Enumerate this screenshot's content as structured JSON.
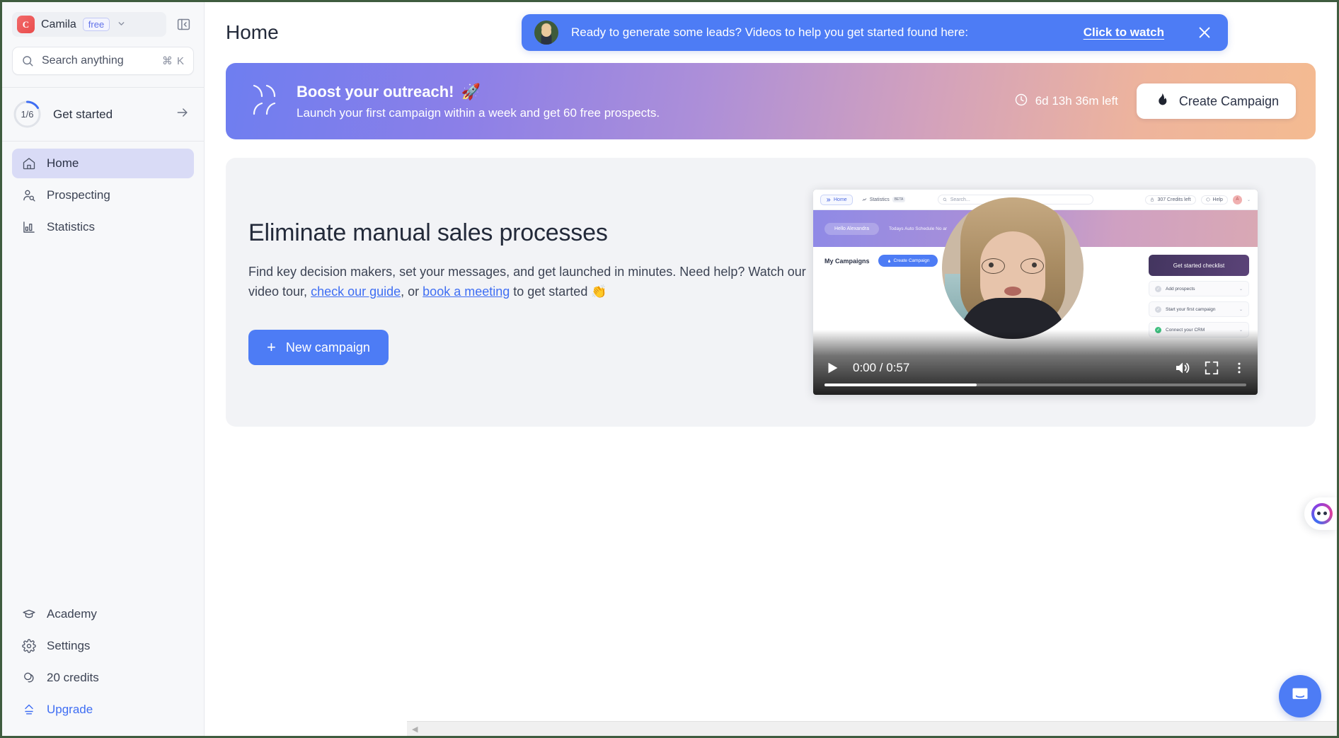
{
  "sidebar": {
    "workspace": {
      "initial": "C",
      "name": "Camila",
      "plan_badge": "free",
      "caret": "chevron-down"
    },
    "collapse_tooltip": "Collapse sidebar",
    "search": {
      "placeholder": "Search anything",
      "shortcut": "⌘ K"
    },
    "get_started": {
      "progress_label": "1/6",
      "label": "Get started",
      "progress_percent": 16.7
    },
    "items": [
      {
        "label": "Home",
        "icon": "home-icon",
        "active": true
      },
      {
        "label": "Prospecting",
        "icon": "person-search-icon",
        "active": false
      },
      {
        "label": "Statistics",
        "icon": "bar-chart-icon",
        "active": false
      }
    ],
    "bottom_items": [
      {
        "label": "Academy",
        "icon": "graduation-cap-icon"
      },
      {
        "label": "Settings",
        "icon": "gear-icon"
      },
      {
        "label": "20 credits",
        "icon": "coins-icon"
      },
      {
        "label": "Upgrade",
        "icon": "upgrade-arrow-icon"
      }
    ]
  },
  "header": {
    "title": "Home"
  },
  "toast": {
    "avatar": "presenter-avatar",
    "message": "Ready to generate some leads? Videos to help you get started found here:",
    "link_label": "Click to watch",
    "close_icon": "close-icon"
  },
  "promo": {
    "icon": "double-chevron-icon",
    "title": "Boost your outreach!",
    "title_emoji": "🚀",
    "subtitle": "Launch your first campaign within a week and get 60 free prospects.",
    "timer_icon": "clock-icon",
    "timer": "6d 13h 36m left",
    "cta_icon": "flame-icon",
    "cta_label": "Create Campaign"
  },
  "hero": {
    "heading": "Eliminate manual sales processes",
    "body_part1": "Find key decision makers, set your messages, and get launched in minutes. Need help? Watch our video tour, ",
    "link1": "check our guide",
    "body_part2": ", or ",
    "link2": "book a meeting",
    "body_part3": " to get started ",
    "body_emoji": "👏",
    "cta_plus": "+",
    "cta_label": "New campaign"
  },
  "video": {
    "current_time": "0:00",
    "separator": " / ",
    "duration": "0:57",
    "time_display": "0:00 / 0:57",
    "progress_percent": 36,
    "play_icon": "play-icon",
    "mute_icon": "volume-icon",
    "fullscreen_icon": "fullscreen-icon",
    "more_icon": "more-vertical-icon",
    "thumbnail": {
      "tab_home": "Home",
      "tab_statistics": "Statistics",
      "beta_badge": "BETA",
      "search_placeholder": "Search...",
      "credits_pill": "307 Credits left",
      "help_label": "Help",
      "avatar_letter": "A",
      "hello_chip": "Hello Alexandra",
      "schedule_text": "Todays Auto Schedule   No ar",
      "my_campaigns": "My Campaigns",
      "create_campaign_btn": "Create Campaign",
      "checklist_title": "Get started checklist",
      "checklist_items": [
        "Add prospects",
        "Start your first campaign",
        "Connect your CRM"
      ]
    }
  },
  "floating": {
    "side_tab_icon": "feedback-blob-icon",
    "intercom_icon": "chat-bubble-icon"
  },
  "scrollbar": {
    "left_arrow": "◀"
  },
  "colors": {
    "accent_blue": "#4d7cf5",
    "link_blue": "#3f6ef3",
    "active_nav_bg": "#d9dbf6",
    "sidebar_bg": "#f7f8fa",
    "hero_card_bg": "#f2f3f6",
    "promo_gradient_start": "#6e7ef0",
    "promo_gradient_end": "#f4bb91",
    "free_badge": "#6071e8"
  }
}
